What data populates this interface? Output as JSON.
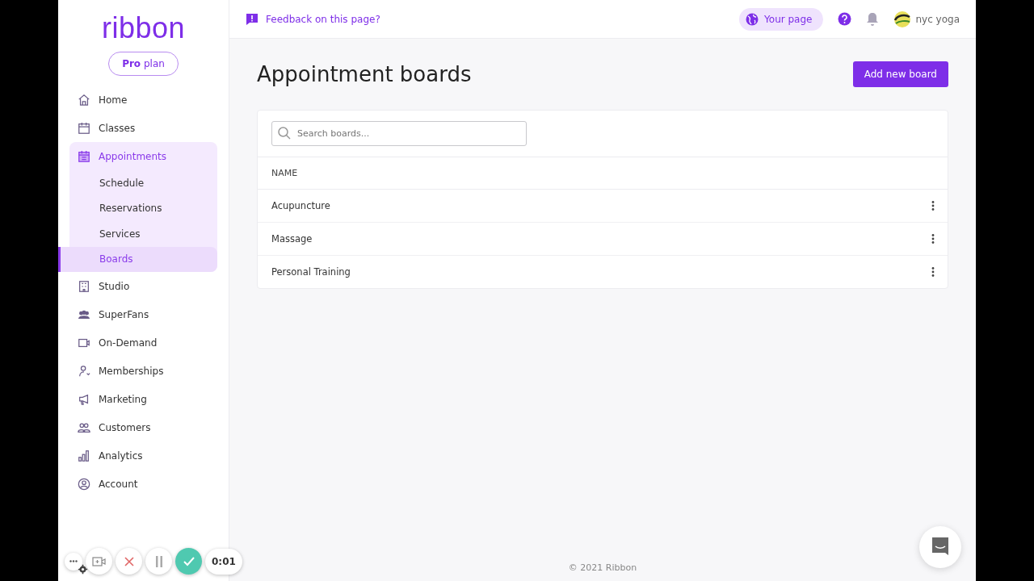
{
  "sidebar": {
    "logo": "ribbon",
    "plan": {
      "bold": "Pro",
      "rest": "plan"
    },
    "items": [
      {
        "label": "Home",
        "selected": false
      },
      {
        "label": "Classes",
        "selected": false
      },
      {
        "label": "Appointments",
        "selected": true,
        "expanded": true,
        "children": [
          {
            "label": "Schedule",
            "selected": false
          },
          {
            "label": "Reservations",
            "selected": false
          },
          {
            "label": "Services",
            "selected": false
          },
          {
            "label": "Boards",
            "selected": true
          }
        ]
      },
      {
        "label": "Studio",
        "selected": false
      },
      {
        "label": "SuperFans",
        "selected": false
      },
      {
        "label": "On-Demand",
        "selected": false
      },
      {
        "label": "Memberships",
        "selected": false
      },
      {
        "label": "Marketing",
        "selected": false
      },
      {
        "label": "Customers",
        "selected": false
      },
      {
        "label": "Analytics",
        "selected": false
      },
      {
        "label": "Account",
        "selected": false
      }
    ]
  },
  "header": {
    "feedback": "Feedback on this page?",
    "your_page": "Your page",
    "account": "nyc yoga"
  },
  "page": {
    "title": "Appointment boards",
    "add_button": "Add new board",
    "search": {
      "placeholder": "Search boards..."
    },
    "table": {
      "columns": [
        "NAME"
      ],
      "rows": [
        "Acupuncture",
        "Massage",
        "Personal Training"
      ]
    }
  },
  "footer": "© 2021 Ribbon",
  "recorder": {
    "timer": "0:01"
  }
}
